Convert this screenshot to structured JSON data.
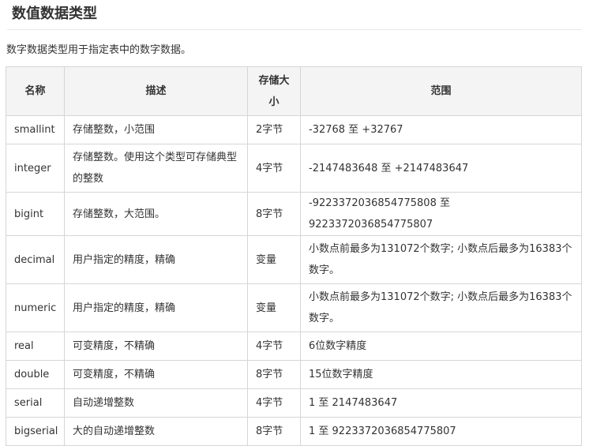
{
  "section": {
    "title": "数值数据类型",
    "intro": "数字数据类型用于指定表中的数字数据。"
  },
  "table": {
    "headers": [
      "名称",
      "描述",
      "存储大小",
      "范围"
    ],
    "rows": [
      [
        "smallint",
        "存储整数，小范围",
        "2字节",
        "-32768 至 +32767"
      ],
      [
        "integer",
        "存储整数。使用这个类型可存储典型的整数",
        "4字节",
        "-2147483648 至 +2147483647"
      ],
      [
        "bigint",
        "存储整数，大范围。",
        "8字节",
        "-9223372036854775808 至 9223372036854775807"
      ],
      [
        "decimal",
        "用户指定的精度，精确",
        "变量",
        "小数点前最多为131072个数字; 小数点后最多为16383个数字。"
      ],
      [
        "numeric",
        "用户指定的精度，精确",
        "变量",
        "小数点前最多为131072个数字; 小数点后最多为16383个数字。"
      ],
      [
        "real",
        "可变精度，不精确",
        "4字节",
        "6位数字精度"
      ],
      [
        "double",
        "可变精度，不精确",
        "8字节",
        "15位数字精度"
      ],
      [
        "serial",
        "自动递增整数",
        "4字节",
        "1 至 2147483647"
      ],
      [
        "bigserial",
        "大的自动递增整数",
        "8字节",
        "1 至 9223372036854775807"
      ]
    ]
  }
}
